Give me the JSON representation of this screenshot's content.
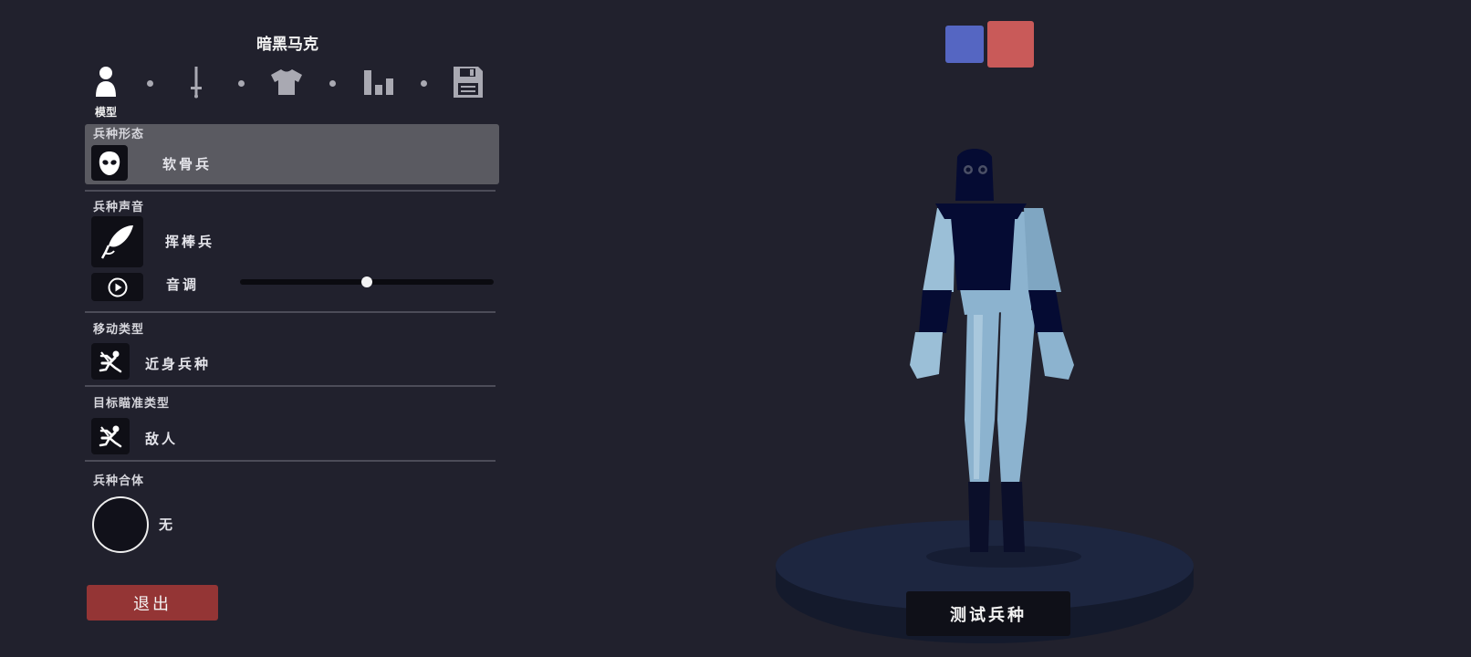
{
  "header": {
    "unit_name": "暗黑马克"
  },
  "tabs": [
    {
      "id": "model",
      "icon": "person-icon",
      "label": "模型",
      "active": true
    },
    {
      "id": "weapons",
      "icon": "sword-icon",
      "active": false
    },
    {
      "id": "clothing",
      "icon": "shirt-icon",
      "active": false
    },
    {
      "id": "stats",
      "icon": "bar-chart-icon",
      "active": false
    },
    {
      "id": "save",
      "icon": "save-disk-icon",
      "active": false
    }
  ],
  "sections": {
    "unit_form": {
      "title": "兵种形态",
      "value": "软骨兵",
      "icon": "mask-face-icon"
    },
    "unit_voice": {
      "title": "兵种声音",
      "value": "挥棒兵",
      "icon": "feather-quill-icon",
      "pitch_label": "音调",
      "pitch_value": 0.5,
      "play_icon": "play-circle-icon"
    },
    "movement": {
      "title": "移动类型",
      "value": "近身兵种",
      "icon": "charging-figure-icon"
    },
    "targeting": {
      "title": "目标瞄准类型",
      "value": "敌人",
      "icon": "charging-figure-icon"
    },
    "fusion": {
      "title": "兵种合体",
      "value": "无"
    }
  },
  "buttons": {
    "exit": "退出",
    "test_unit": "测试兵种"
  },
  "team_colors": {
    "blue": "#5566c2",
    "red": "#c95a59"
  },
  "accent_colors": {
    "exit_button": "#943535",
    "selected_row": "#5a5a61",
    "background": "#21212d"
  }
}
